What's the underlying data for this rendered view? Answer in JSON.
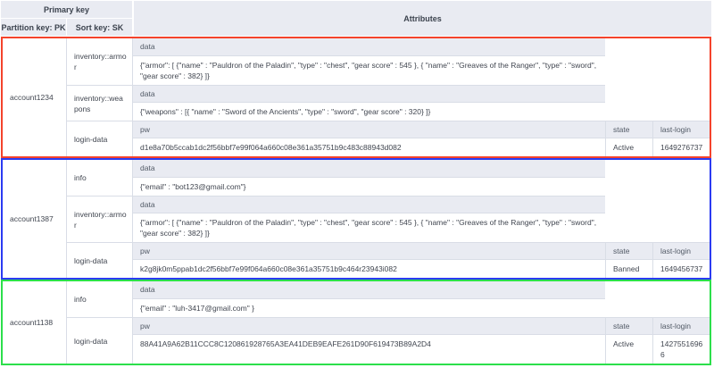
{
  "header": {
    "primary_key_label": "Primary key",
    "partition_key_label": "Partition key: PK",
    "sort_key_label": "Sort key: SK",
    "attributes_label": "Attributes"
  },
  "labels": {
    "data": "data",
    "pw": "pw",
    "state": "state",
    "last_login": "last-login"
  },
  "colors": {
    "section_red": "#f4432c",
    "section_blue": "#2b3bf2",
    "section_green": "#2cdf4b",
    "header_bg": "#e9ebf2",
    "grid_line": "#d9dde6"
  },
  "sections": [
    {
      "pk": "account1234",
      "color": "section_red",
      "rows": [
        {
          "sk": "inventory::armor",
          "kind": "data",
          "value": "{\"armor\": [ {\"name\" : \"Pauldron of the Paladin\", \"type\" : \"chest\", \"gear score\" : 545 }, { \"name\" : \"Greaves of the Ranger\", \"type\" : \"sword\", \"gear score\" : 382} ]}"
        },
        {
          "sk": "inventory::weapons",
          "kind": "data",
          "value": "{\"weapons\" : [{ \"name\" : \"Sword of the Ancients\", \"type\" : \"sword\", \"gear score\" : 320} ]}"
        },
        {
          "sk": "login-data",
          "kind": "login",
          "pw": "d1e8a70b5ccab1dc2f56bbf7e99f064a660c08e361a35751b9c483c88943d082",
          "state": "Active",
          "last_login": "1649276737"
        }
      ]
    },
    {
      "pk": "account1387",
      "color": "section_blue",
      "rows": [
        {
          "sk": "info",
          "kind": "data",
          "value": "{\"email\" : \"bot123@gmail.com\"}"
        },
        {
          "sk": "inventory::armor",
          "kind": "data",
          "value": "{\"armor\": [ {\"name\" : \"Pauldron of the Paladin\", \"type\" : \"chest\", \"gear score\" : 545 }, { \"name\" : \"Greaves of the Ranger\", \"type\" : \"sword\", \"gear score\" : 382} ]}"
        },
        {
          "sk": "login-data",
          "kind": "login",
          "pw": "k2g8jk0m5ppab1dc2f56bbf7e99f064a660c08e361a35751b9c464r23943i082",
          "state": "Banned",
          "last_login": "1649456737"
        }
      ]
    },
    {
      "pk": "account1138",
      "color": "section_green",
      "rows": [
        {
          "sk": "info",
          "kind": "data",
          "value": "{\"email\" : \"luh-3417@gmail.com\" }"
        },
        {
          "sk": "login-data",
          "kind": "login",
          "pw": "88A41A9A62B11CCC8C120861928765A3EA41DEB9EAFE261D90F619473B89A2D4",
          "state": "Active",
          "last_login": "14275516966"
        }
      ]
    }
  ]
}
